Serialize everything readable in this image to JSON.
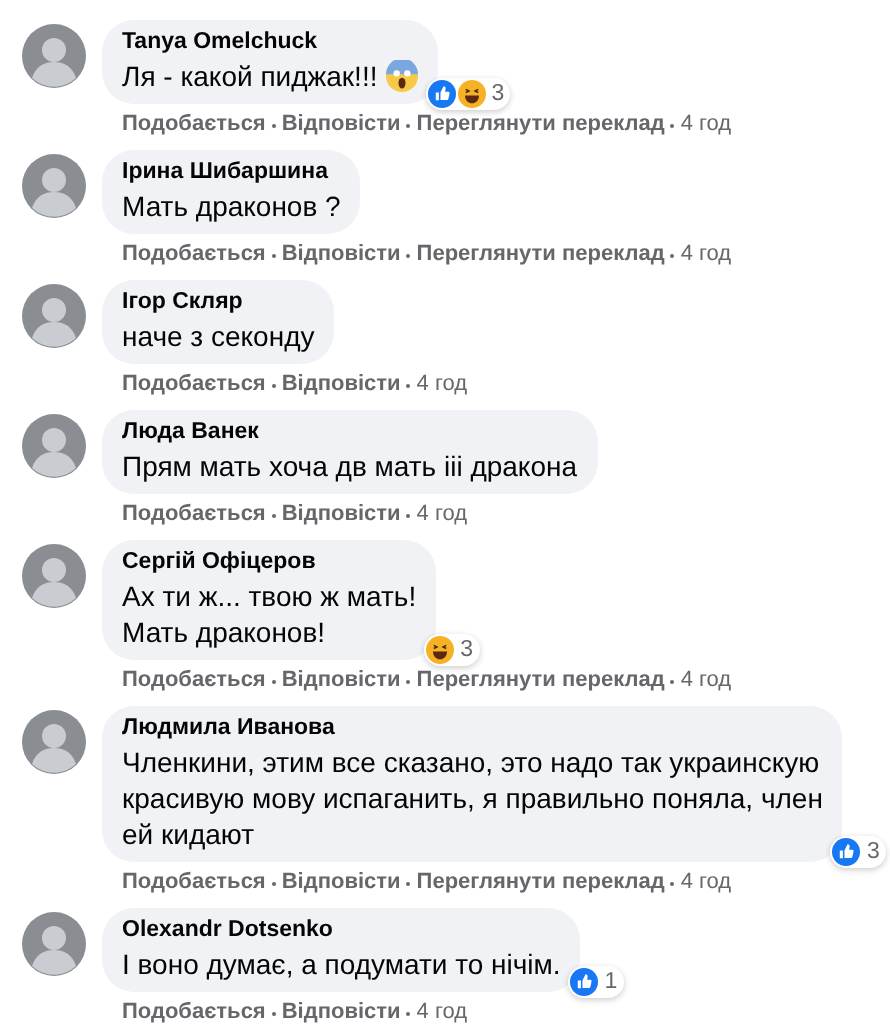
{
  "comments": [
    {
      "author": "Tanya Omelchuck",
      "text": "Ля - какой пиджак!!!",
      "scream_emoji": true,
      "reactions": {
        "like": true,
        "haha": true,
        "count": "3"
      },
      "actions": [
        {
          "label": "Подобається",
          "kind": "link"
        },
        {
          "label": "Відповісти",
          "kind": "link"
        },
        {
          "label": "Переглянути переклад",
          "kind": "link"
        },
        {
          "label": "4 год",
          "kind": "time"
        }
      ]
    },
    {
      "author": "Ірина Шибаршина",
      "text": "Мать драконов ?",
      "scream_emoji": false,
      "actions": [
        {
          "label": "Подобається",
          "kind": "link"
        },
        {
          "label": "Відповісти",
          "kind": "link"
        },
        {
          "label": "Переглянути переклад",
          "kind": "link"
        },
        {
          "label": "4 год",
          "kind": "time"
        }
      ]
    },
    {
      "author": "Ігор Скляр",
      "text": "наче з секонду",
      "scream_emoji": false,
      "actions": [
        {
          "label": "Подобається",
          "kind": "link"
        },
        {
          "label": "Відповісти",
          "kind": "link"
        },
        {
          "label": "4 год",
          "kind": "time"
        }
      ]
    },
    {
      "author": "Люда Ванек",
      "text": "Прям мать хоча дв мать ііі дракона",
      "scream_emoji": false,
      "actions": [
        {
          "label": "Подобається",
          "kind": "link"
        },
        {
          "label": "Відповісти",
          "kind": "link"
        },
        {
          "label": "4 год",
          "kind": "time"
        }
      ]
    },
    {
      "author": "Сергій Офіцеров",
      "text": "Ах ти ж... твою ж мать!\nМать драконов!",
      "scream_emoji": false,
      "reactions": {
        "like": false,
        "haha": true,
        "count": "3"
      },
      "actions": [
        {
          "label": "Подобається",
          "kind": "link"
        },
        {
          "label": "Відповісти",
          "kind": "link"
        },
        {
          "label": "Переглянути переклад",
          "kind": "link"
        },
        {
          "label": "4 год",
          "kind": "time"
        }
      ]
    },
    {
      "author": "Людмила Иванова",
      "text": "Членкини, этим все сказано, это надо так украинскую\nкрасивую мову испаганить, я правильно поняла, член\nей кидают",
      "scream_emoji": false,
      "reactions": {
        "like": true,
        "haha": false,
        "count": "3"
      },
      "actions": [
        {
          "label": "Подобається",
          "kind": "link"
        },
        {
          "label": "Відповісти",
          "kind": "link"
        },
        {
          "label": "Переглянути переклад",
          "kind": "link"
        },
        {
          "label": "4 год",
          "kind": "time"
        }
      ]
    },
    {
      "author": "Olexandr Dotsenko",
      "text": "І воно думає, а подумати то нічім.",
      "scream_emoji": false,
      "reactions": {
        "like": true,
        "haha": false,
        "count": "1"
      },
      "actions": [
        {
          "label": "Подобається",
          "kind": "link"
        },
        {
          "label": "Відповісти",
          "kind": "link"
        },
        {
          "label": "4 год",
          "kind": "time"
        }
      ]
    }
  ]
}
